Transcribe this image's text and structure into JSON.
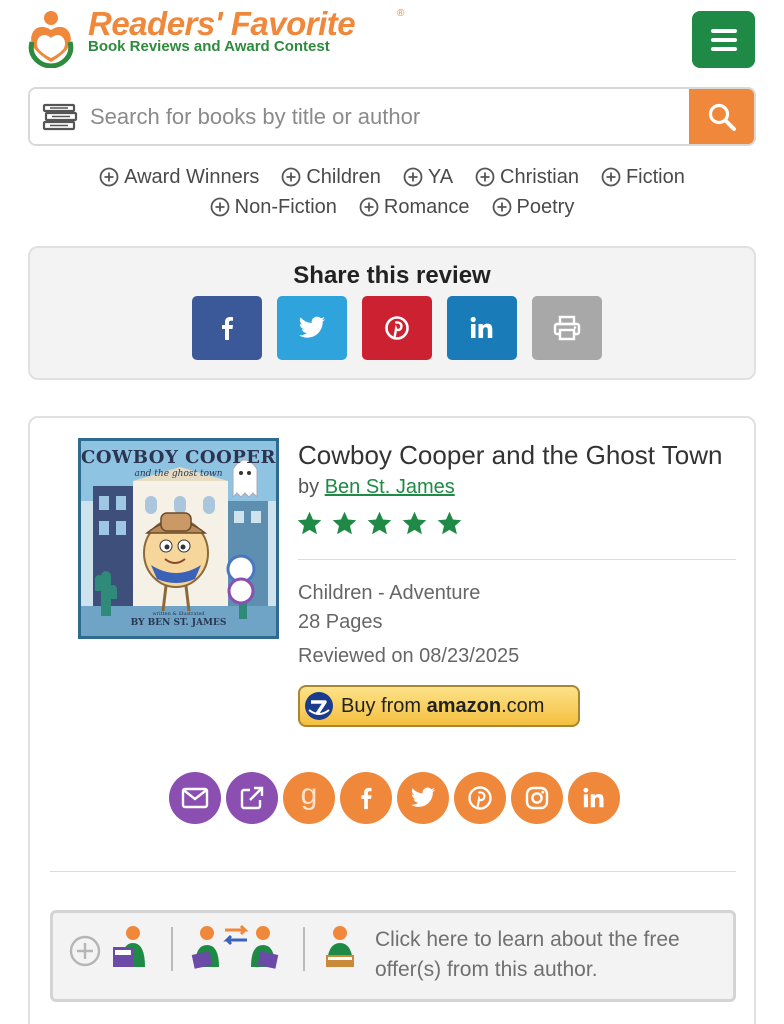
{
  "header": {
    "brand_name": "Readers' Favorite",
    "registered_mark": "®",
    "tagline": "Book Reviews and Award Contest",
    "menu_icon": "hamburger-icon",
    "colors": {
      "brand_orange": "#f0883c",
      "brand_green": "#1e8a45"
    }
  },
  "search": {
    "placeholder": "Search for books by title or author",
    "value": "",
    "left_icon": "books-icon",
    "button_icon": "search-icon"
  },
  "categories": {
    "row1": [
      "Award Winners",
      "Children",
      "YA",
      "Christian",
      "Fiction"
    ],
    "row2": [
      "Non-Fiction",
      "Romance",
      "Poetry"
    ]
  },
  "share": {
    "title": "Share this review",
    "buttons": [
      {
        "icon": "facebook-icon",
        "color": "#3b5998"
      },
      {
        "icon": "twitter-icon",
        "color": "#2ea3dc"
      },
      {
        "icon": "pinterest-icon",
        "color": "#cc2131"
      },
      {
        "icon": "linkedin-icon",
        "color": "#1a7bb9"
      },
      {
        "icon": "print-icon",
        "color": "#a8a8a8"
      }
    ]
  },
  "book": {
    "cover": {
      "title_line1": "COWBOY COOPER",
      "title_line2": "and the ghost town",
      "credit_small": "written & illustrated",
      "credit_author": "BY BEN ST. JAMES"
    },
    "title": "Cowboy Cooper and the Ghost Town",
    "by_prefix": "by",
    "author": "Ben St. James",
    "rating": 5,
    "rating_max": 5,
    "genre": "Children - Adventure",
    "pages": "28 Pages",
    "reviewed": "Reviewed on 08/23/2025",
    "amazon": {
      "prefix": "Buy from",
      "brand": "amazon",
      "suffix": ".com"
    }
  },
  "author_social": [
    {
      "icon": "email-icon",
      "color": "#8a4fb1"
    },
    {
      "icon": "external-link-icon",
      "color": "#8a4fb1"
    },
    {
      "icon": "goodreads-icon",
      "color": "#f0883c",
      "glyph": "g"
    },
    {
      "icon": "facebook-icon",
      "color": "#f0883c"
    },
    {
      "icon": "twitter-icon",
      "color": "#f0883c"
    },
    {
      "icon": "pinterest-icon",
      "color": "#f0883c"
    },
    {
      "icon": "instagram-icon",
      "color": "#f0883c"
    },
    {
      "icon": "linkedin-icon",
      "color": "#f0883c"
    }
  ],
  "offer": {
    "text": "Click here to learn about the free offer(s) from this author.",
    "icons": [
      "plus-circle-icon",
      "reader-book-icon",
      "book-exchange-icon",
      "reader-icon"
    ]
  }
}
